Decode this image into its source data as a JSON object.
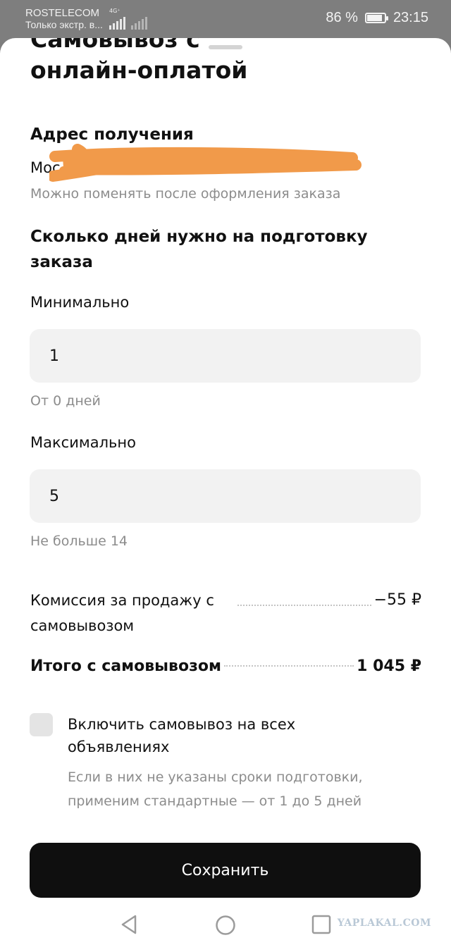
{
  "status_bar": {
    "carrier": "ROSTELECOM",
    "carrier_sub": "Только экстр. в...",
    "network": "4G⁺",
    "battery": "86 %",
    "battery_level": 0.86,
    "time": "23:15"
  },
  "sheet": {
    "title": [
      "Самовывоз с",
      "онлайн-оплатой"
    ],
    "address": {
      "heading": "Адрес получения",
      "value_visible": "Мос",
      "hint": "Можно поменять после оформления заказа"
    },
    "prep_days": {
      "heading": "Сколько дней нужно на подготовку заказа",
      "min_label": "Минимально",
      "min_value": "1",
      "min_hint": "От 0 дней",
      "max_label": "Максимально",
      "max_value": "5",
      "max_hint": "Не больше 14"
    },
    "summary": {
      "commission_label": "Комиссия за продажу с самовывозом",
      "commission_value": "−55 ₽",
      "total_label": "Итого с самовывозом",
      "total_value": "1 045 ₽"
    },
    "apply_all": {
      "label": "Включить самовывоз на всех объявлениях",
      "hint": "Если в них не указаны сроки подготовки, применим стандартные — от 1 до 5 дней",
      "checked": false
    },
    "save_label": "Сохранить"
  },
  "watermark": "YAPLAKAL.COM",
  "colors": {
    "redaction": "#f19a4a",
    "primary_button": "#0f0f0f",
    "field_bg": "#f2f2f2"
  }
}
